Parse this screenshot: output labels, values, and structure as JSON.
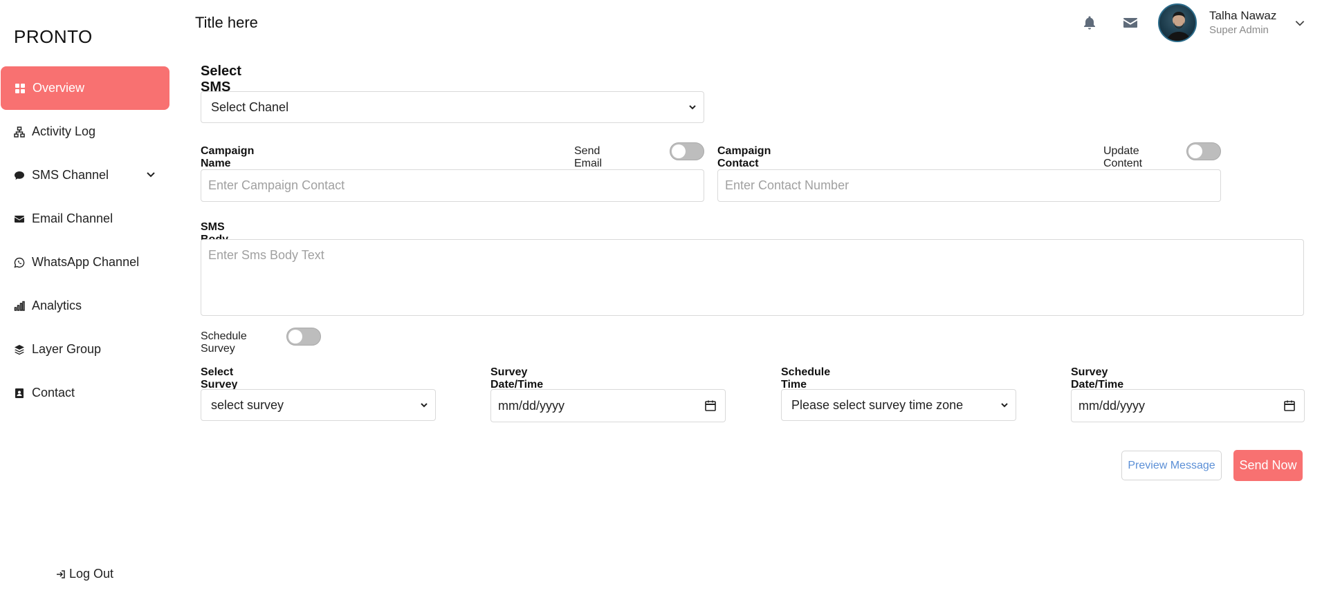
{
  "app": {
    "brand": "PRONTO"
  },
  "sidebar": {
    "items": [
      {
        "label": "Overview",
        "icon": "grid-icon",
        "active": true
      },
      {
        "label": "Activity Log",
        "icon": "sitemap-icon"
      },
      {
        "label": "SMS Channel",
        "icon": "chat-bubble-icon",
        "has_submenu": true
      },
      {
        "label": "Email Channel",
        "icon": "envelope-icon"
      },
      {
        "label": "WhatsApp Channel",
        "icon": "whatsapp-icon"
      },
      {
        "label": "Analytics",
        "icon": "bar-chart-icon"
      },
      {
        "label": "Layer Group",
        "icon": "layers-icon"
      },
      {
        "label": "Contact",
        "icon": "contact-card-icon"
      }
    ],
    "logout_label": "Log Out"
  },
  "header": {
    "title": "Title here",
    "user": {
      "name": "Talha Nawaz",
      "role": "Super Admin"
    }
  },
  "form": {
    "section_title": "Select SMS Channel",
    "channel_select_value": "Select Chanel",
    "campaign_name_label": "Campaign Name",
    "send_email_sms_label": "Send Email & SMS",
    "campaign_name_placeholder": "Enter Campaign Contact",
    "campaign_contact_label": "Campaign Contact",
    "update_content_label": "Update Content",
    "campaign_contact_placeholder": "Enter Contact Number",
    "sms_body_label": "SMS Body Text",
    "sms_body_placeholder": "Enter Sms Body Text",
    "schedule_survey_label": "Schedule Survey",
    "survey_template_label": "Select Survey Template",
    "survey_template_value": "select survey",
    "survey_date_label_1": "Survey Date/Time",
    "survey_date_value_1": "mm/dd/yyyy",
    "time_zone_label": "Schedule Time Zone",
    "time_zone_value": "Please select survey time zone",
    "survey_date_label_2": "Survey Date/Time",
    "survey_date_value_2": "mm/dd/yyyy",
    "preview_button": "Preview Message",
    "send_button": "Send Now"
  },
  "colors": {
    "accent": "#f87171",
    "link_blue": "#5b8fd6"
  }
}
